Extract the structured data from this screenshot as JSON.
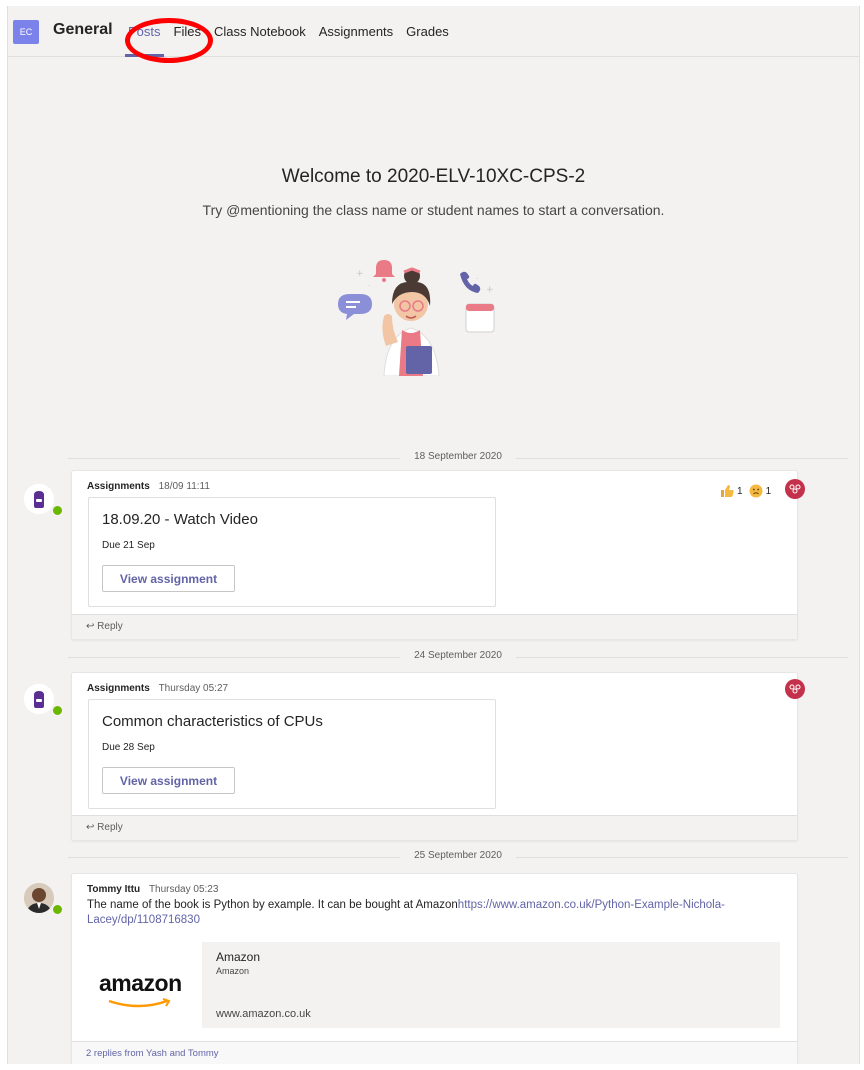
{
  "header": {
    "team_initials": "EC",
    "channel_name": "General",
    "tabs": [
      "Posts",
      "Files",
      "Class Notebook",
      "Assignments",
      "Grades"
    ]
  },
  "welcome": {
    "title": "Welcome to 2020-ELV-10XC-CPS-2",
    "subtitle": "Try @mentioning the class name or student names to start a conversation."
  },
  "dates": [
    "18 September 2020",
    "24 September 2020",
    "25 September 2020"
  ],
  "messages": [
    {
      "author": "Assignments",
      "time": "18/09 11:11",
      "assignment_title": "18.09.20 - Watch Video",
      "due": "Due 21 Sep",
      "button": "View assignment",
      "reply": "Reply",
      "reactions": [
        {
          "icon": "thumbs-up-icon",
          "count": "1"
        },
        {
          "icon": "sad-face-icon",
          "count": "1"
        }
      ]
    },
    {
      "author": "Assignments",
      "time": "Thursday 05:27",
      "assignment_title": "Common characteristics of CPUs",
      "due": "Due 28 Sep",
      "button": "View assignment",
      "reply": "Reply"
    },
    {
      "author": "Tommy Ittu",
      "time": "Thursday 05:23",
      "text": "The name of the book is Python by example. It can be bought at Amazon",
      "link": "https://www.amazon.co.uk/Python-Example-Nichola-Lacey/dp/1108716830",
      "preview": {
        "logo_text": "amazon",
        "title": "Amazon",
        "description": "Amazon",
        "url": "www.amazon.co.uk"
      },
      "replies": "2 replies from Yash and Tommy"
    }
  ],
  "colors": {
    "accent": "#6264a7",
    "team_avatar": "#7b83eb",
    "background": "#f3f2f1",
    "annotation_circle": "#ff0000",
    "group_icon": "#c4314b",
    "presence": "#6bb700"
  }
}
